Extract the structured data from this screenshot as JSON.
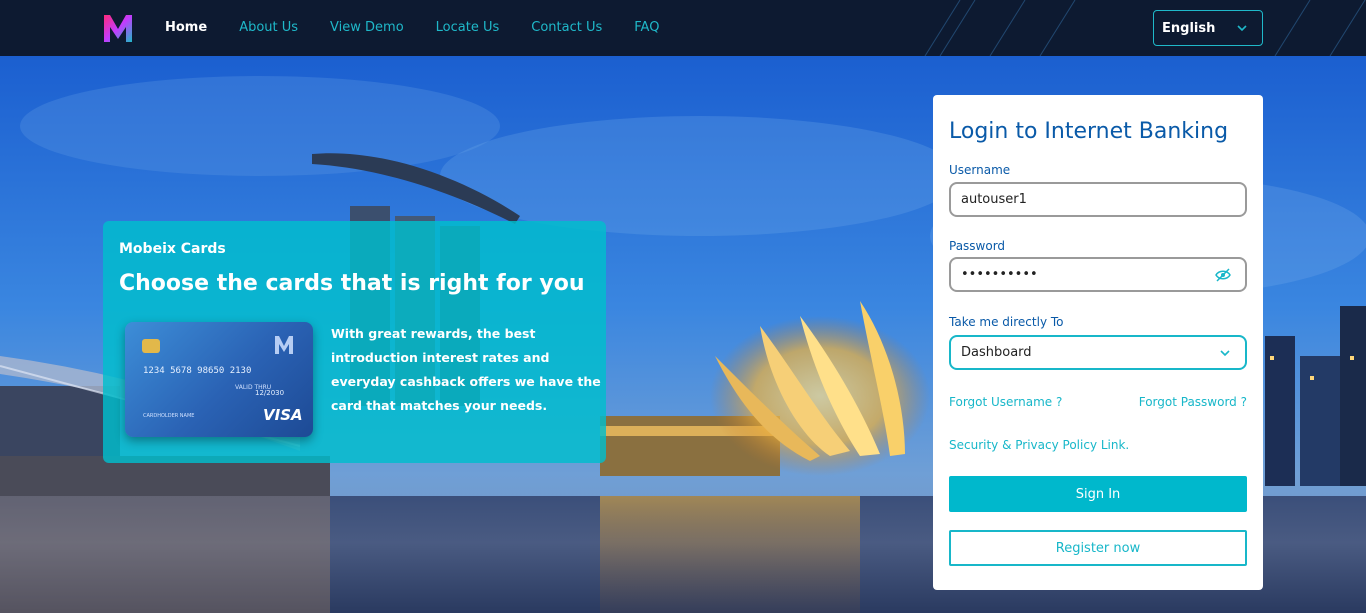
{
  "nav": {
    "logo_letter": "M",
    "items": [
      {
        "label": "Home",
        "active": true
      },
      {
        "label": "About Us"
      },
      {
        "label": "View Demo"
      },
      {
        "label": "Locate Us"
      },
      {
        "label": "Contact Us"
      },
      {
        "label": "FAQ"
      }
    ],
    "language": "English"
  },
  "promo": {
    "kicker": "Mobeix Cards",
    "headline": "Choose the cards that is right for you",
    "description": "With great rewards, the best introduction interest rates and everyday cashback offers we have the card that matches your needs.",
    "card": {
      "number": "1234 5678 98650 2130",
      "valid_thru_label": "VALID THRU",
      "expiry": "12/2030",
      "holder_label": "CARDHOLDER NAME",
      "brand": "VISA"
    }
  },
  "login": {
    "title": "Login to Internet Banking",
    "username_label": "Username",
    "username_value": "autouser1",
    "password_label": "Password",
    "password_value": "••••••••••",
    "destination_label": "Take me directly To",
    "destination_value": "Dashboard",
    "forgot_username": "Forgot Username ?",
    "forgot_password": "Forgot Password ?",
    "privacy_link": "Security & Privacy Policy Link.",
    "sign_in": "Sign In",
    "register": "Register now"
  },
  "colors": {
    "nav_bg": "#0d1a31",
    "accent": "#1fb8c9",
    "title_blue": "#0a5aa8",
    "primary_button": "#00b8cc"
  }
}
